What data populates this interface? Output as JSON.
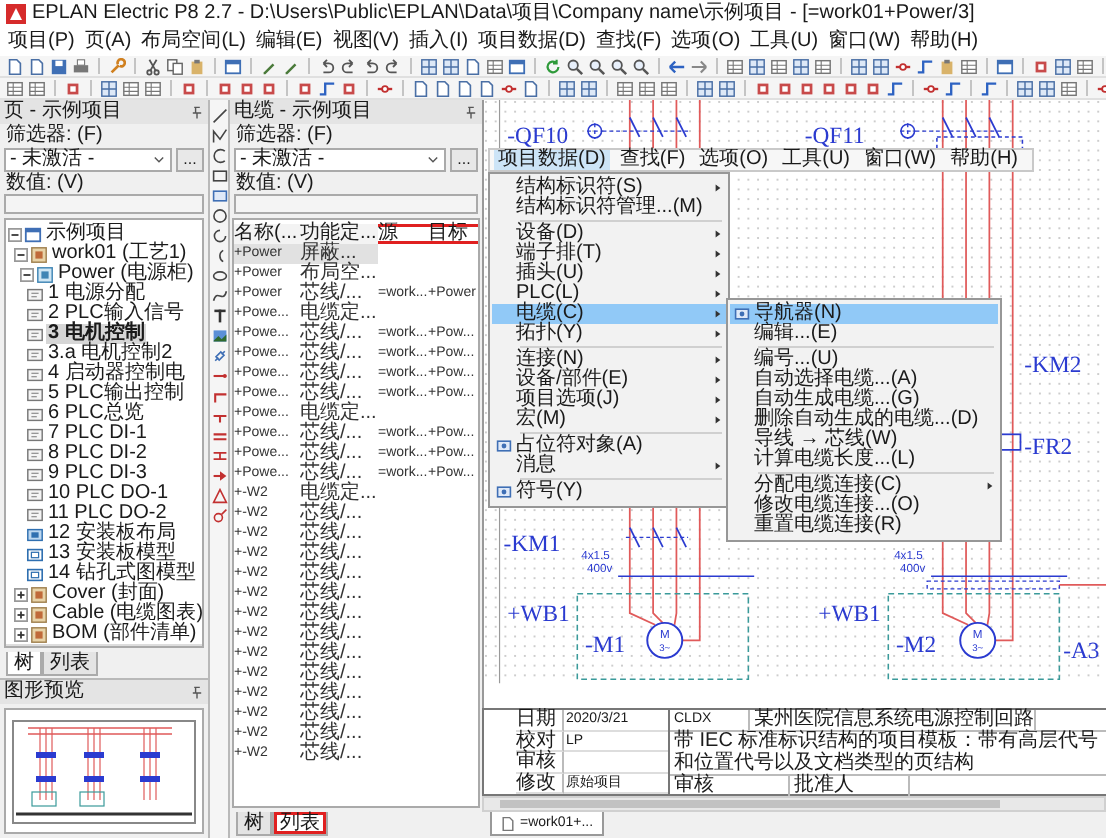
{
  "window": {
    "title": "EPLAN Electric P8 2.7 - D:\\Users\\Public\\EPLAN\\Data\\项目\\Company name\\示例项目 - [=work01+Power/3]"
  },
  "menu_bar": [
    "项目(P)",
    "页(A)",
    "布局空间(L)",
    "编辑(E)",
    "视图(V)",
    "插入(I)",
    "项目数据(D)",
    "查找(F)",
    "选项(O)",
    "工具(U)",
    "窗口(W)",
    "帮助(H)"
  ],
  "page_panel": {
    "title": "页 - 示例项目",
    "filter_label": "筛选器: (F)",
    "filter_value": "- 未激活 -",
    "filter_button": "...",
    "values_label": "数值: (V)",
    "tree": [
      {
        "label": "示例项目",
        "kind": "project",
        "expanded": true,
        "selected": false,
        "children": [
          {
            "label": "work01 (工艺1)",
            "kind": "function",
            "expanded": true,
            "selected": false,
            "children": [
              {
                "label": "Power (电源柜)",
                "kind": "location",
                "expanded": true,
                "selected": false,
                "children": [
                  {
                    "label": "1 电源分配",
                    "kind": "schematic",
                    "selected": false
                  },
                  {
                    "label": "2 PLC输入信号",
                    "kind": "schematic",
                    "selected": false
                  },
                  {
                    "label": "3 电机控制",
                    "kind": "schematic",
                    "selected": true
                  },
                  {
                    "label": "3.a 电机控制2",
                    "kind": "schematic",
                    "selected": false
                  },
                  {
                    "label": "4 启动器控制电",
                    "kind": "schematic",
                    "selected": false
                  },
                  {
                    "label": "5 PLC输出控制",
                    "kind": "schematic",
                    "selected": false
                  },
                  {
                    "label": "6 PLC总览",
                    "kind": "schematic",
                    "selected": false
                  },
                  {
                    "label": "7 PLC DI-1",
                    "kind": "schematic",
                    "selected": false
                  },
                  {
                    "label": "8 PLC DI-2",
                    "kind": "schematic",
                    "selected": false
                  },
                  {
                    "label": "9 PLC DI-3",
                    "kind": "schematic",
                    "selected": false
                  },
                  {
                    "label": "10 PLC DO-1",
                    "kind": "schematic",
                    "selected": false
                  },
                  {
                    "label": "11 PLC DO-2",
                    "kind": "schematic",
                    "selected": false
                  },
                  {
                    "label": "12 安装板布局",
                    "kind": "layout",
                    "selected": false
                  },
                  {
                    "label": "13 安装板模型",
                    "kind": "model",
                    "selected": false
                  },
                  {
                    "label": "14 钻孔式图模型",
                    "kind": "model",
                    "selected": false
                  }
                ]
              }
            ]
          },
          {
            "label": "Cover (封面)",
            "kind": "function",
            "expanded": false,
            "selected": false
          },
          {
            "label": "Cable (电缆图表)",
            "kind": "function",
            "expanded": false,
            "selected": false
          },
          {
            "label": "BOM (部件清单)",
            "kind": "function",
            "expanded": false,
            "selected": false
          }
        ]
      }
    ],
    "tabs": [
      {
        "label": "树",
        "selected": true,
        "highlighted": false
      },
      {
        "label": "列表",
        "selected": false,
        "highlighted": false
      }
    ]
  },
  "graphic_preview": {
    "title": "图形预览"
  },
  "cable_panel": {
    "title": "电缆 - 示例项目",
    "filter_label": "筛选器: (F)",
    "filter_value": "- 未激活 -",
    "filter_button": "...",
    "values_label": "数值: (V)",
    "columns": [
      {
        "label": "名称(...",
        "highlighted": false
      },
      {
        "label": "功能定...",
        "highlighted": false
      },
      {
        "label": "源",
        "highlighted": true
      },
      {
        "label": "目标",
        "highlighted": true
      }
    ],
    "rows": [
      {
        "cells": [
          "+Power",
          "屏蔽..."
        ],
        "selected": true
      },
      {
        "cells": [
          "+Power",
          "布局空..."
        ],
        "selected": false
      },
      {
        "cells": [
          "+Power",
          "芯线/...",
          "=work...",
          "+Power"
        ],
        "selected": false
      },
      {
        "cells": [
          "+Powe...",
          "电缆定..."
        ],
        "selected": false
      },
      {
        "cells": [
          "+Powe...",
          "芯线/...",
          "=work...",
          "+Pow..."
        ],
        "selected": false
      },
      {
        "cells": [
          "+Powe...",
          "芯线/...",
          "=work...",
          "+Pow..."
        ],
        "selected": false
      },
      {
        "cells": [
          "+Powe...",
          "芯线/...",
          "=work...",
          "+Pow..."
        ],
        "selected": false
      },
      {
        "cells": [
          "+Powe...",
          "芯线/...",
          "=work...",
          "+Pow..."
        ],
        "selected": false
      },
      {
        "cells": [
          "+Powe...",
          "电缆定..."
        ],
        "selected": false
      },
      {
        "cells": [
          "+Powe...",
          "芯线/...",
          "=work...",
          "+Pow..."
        ],
        "selected": false
      },
      {
        "cells": [
          "+Powe...",
          "芯线/...",
          "=work...",
          "+Pow..."
        ],
        "selected": false
      },
      {
        "cells": [
          "+Powe...",
          "芯线/...",
          "=work...",
          "+Pow..."
        ],
        "selected": false
      },
      {
        "cells": [
          "+-W2",
          "电缆定..."
        ],
        "selected": false
      },
      {
        "cells": [
          "+-W2",
          "芯线/..."
        ],
        "selected": false
      },
      {
        "cells": [
          "+-W2",
          "芯线/..."
        ],
        "selected": false
      },
      {
        "cells": [
          "+-W2",
          "芯线/..."
        ],
        "selected": false
      },
      {
        "cells": [
          "+-W2",
          "芯线/..."
        ],
        "selected": false
      },
      {
        "cells": [
          "+-W2",
          "芯线/..."
        ],
        "selected": false
      },
      {
        "cells": [
          "+-W2",
          "芯线/..."
        ],
        "selected": false
      },
      {
        "cells": [
          "+-W2",
          "芯线/..."
        ],
        "selected": false
      },
      {
        "cells": [
          "+-W2",
          "芯线/..."
        ],
        "selected": false
      },
      {
        "cells": [
          "+-W2",
          "芯线/..."
        ],
        "selected": false
      },
      {
        "cells": [
          "+-W2",
          "芯线/..."
        ],
        "selected": false
      },
      {
        "cells": [
          "+-W2",
          "芯线/..."
        ],
        "selected": false
      },
      {
        "cells": [
          "+-W2",
          "芯线/..."
        ],
        "selected": false
      },
      {
        "cells": [
          "+-W2",
          "芯线/..."
        ],
        "selected": false
      }
    ],
    "tabs": [
      {
        "label": "树",
        "selected": false,
        "highlighted": false
      },
      {
        "label": "列表",
        "selected": true,
        "highlighted": true
      }
    ]
  },
  "schematic": {
    "breakers": [
      "-QF10",
      "-QF11"
    ],
    "contactors": [
      "-KM1",
      "-KM2"
    ],
    "relay": "-FR2",
    "cables": [
      {
        "size": "4x1.5",
        "voltage": "400v"
      },
      {
        "size": "4x1.5",
        "voltage": "400v"
      }
    ],
    "locations": [
      "+WB1",
      "+WB1"
    ],
    "motors": [
      {
        "label": "-M1",
        "symbol": "M",
        "phases": "3~"
      },
      {
        "label": "-M2",
        "symbol": "M",
        "phases": "3~"
      }
    ],
    "device": "-A3"
  },
  "embedded_menu": {
    "menu_bar": [
      {
        "label": "项目数据(D)",
        "selected": true
      },
      {
        "label": "查找(F)",
        "selected": false
      },
      {
        "label": "选项(O)",
        "selected": false
      },
      {
        "label": "工具(U)",
        "selected": false
      },
      {
        "label": "窗口(W)",
        "selected": false
      },
      {
        "label": "帮助(H)",
        "selected": false
      }
    ],
    "menu": [
      {
        "kind": "item",
        "label": "结构标识符(S)",
        "has_submenu": true,
        "has_icon": false,
        "selected": false
      },
      {
        "kind": "item",
        "label": "结构标识符管理...(M)",
        "has_submenu": false,
        "has_icon": false,
        "selected": false
      },
      {
        "kind": "separator"
      },
      {
        "kind": "item",
        "label": "设备(D)",
        "has_submenu": true,
        "has_icon": false,
        "selected": false
      },
      {
        "kind": "item",
        "label": "端子排(T)",
        "has_submenu": true,
        "has_icon": false,
        "selected": false
      },
      {
        "kind": "item",
        "label": "插头(U)",
        "has_submenu": true,
        "has_icon": false,
        "selected": false
      },
      {
        "kind": "item",
        "label": "PLC(L)",
        "has_submenu": true,
        "has_icon": false,
        "selected": false
      },
      {
        "kind": "item",
        "label": "电缆(C)",
        "has_submenu": true,
        "has_icon": false,
        "selected": true
      },
      {
        "kind": "item",
        "label": "拓扑(Y)",
        "has_submenu": true,
        "has_icon": false,
        "selected": false
      },
      {
        "kind": "separator"
      },
      {
        "kind": "item",
        "label": "连接(N)",
        "has_submenu": true,
        "has_icon": false,
        "selected": false
      },
      {
        "kind": "item",
        "label": "设备/部件(E)",
        "has_submenu": true,
        "has_icon": false,
        "selected": false
      },
      {
        "kind": "item",
        "label": "项目选项(J)",
        "has_submenu": true,
        "has_icon": false,
        "selected": false
      },
      {
        "kind": "item",
        "label": "宏(M)",
        "has_submenu": true,
        "has_icon": false,
        "selected": false
      },
      {
        "kind": "separator"
      },
      {
        "kind": "item",
        "label": "占位符对象(A)",
        "has_submenu": false,
        "has_icon": true,
        "selected": false
      },
      {
        "kind": "item",
        "label": "消息",
        "has_submenu": true,
        "has_icon": false,
        "selected": false
      },
      {
        "kind": "separator"
      },
      {
        "kind": "item",
        "label": "符号(Y)",
        "has_submenu": false,
        "has_icon": true,
        "selected": false
      }
    ],
    "submenu": [
      {
        "kind": "item",
        "label": "导航器(N)",
        "has_submenu": false,
        "has_icon": true,
        "selected": true
      },
      {
        "kind": "item",
        "label": "编辑...(E)",
        "has_submenu": false,
        "has_icon": false,
        "selected": false
      },
      {
        "kind": "separator"
      },
      {
        "kind": "item",
        "label": "编号...(U)",
        "has_submenu": false,
        "has_icon": false,
        "selected": false
      },
      {
        "kind": "item",
        "label": "自动选择电缆...(A)",
        "has_submenu": false,
        "has_icon": false,
        "selected": false
      },
      {
        "kind": "item",
        "label": "自动生成电缆...(G)",
        "has_submenu": false,
        "has_icon": false,
        "selected": false
      },
      {
        "kind": "item",
        "label": "删除自动生成的电缆...(D)",
        "has_submenu": false,
        "has_icon": false,
        "selected": false
      },
      {
        "kind": "item",
        "label": "导线 → 芯线(W)",
        "has_submenu": false,
        "has_icon": false,
        "selected": false
      },
      {
        "kind": "item",
        "label": "计算电缆长度...(L)",
        "has_submenu": false,
        "has_icon": false,
        "selected": false
      },
      {
        "kind": "separator"
      },
      {
        "kind": "item",
        "label": "分配电缆连接(C)",
        "has_submenu": true,
        "has_icon": false,
        "selected": false
      },
      {
        "kind": "item",
        "label": "修改电缆连接...(O)",
        "has_submenu": false,
        "has_icon": false,
        "selected": false
      },
      {
        "kind": "item",
        "label": "重置电缆连接(R)",
        "has_submenu": false,
        "has_icon": false,
        "selected": false
      }
    ]
  },
  "title_block": {
    "fields": [
      {
        "label": "日期",
        "value": "2020/3/21"
      },
      {
        "label": "校对",
        "value": "LP"
      },
      {
        "label": "审核"
      },
      {
        "label": "修改",
        "value": "原始项目"
      }
    ],
    "code": "CLDX",
    "company": "某州医院信息系统电源控制回路",
    "description": "带 IEC 标准标识结构的项目模板：带有高层代号和位置代号以及文档类型的页结构",
    "signatures": [
      "审核",
      "批准人"
    ]
  },
  "document_tabs": [
    {
      "label": "=work01+...",
      "selected": true
    }
  ]
}
